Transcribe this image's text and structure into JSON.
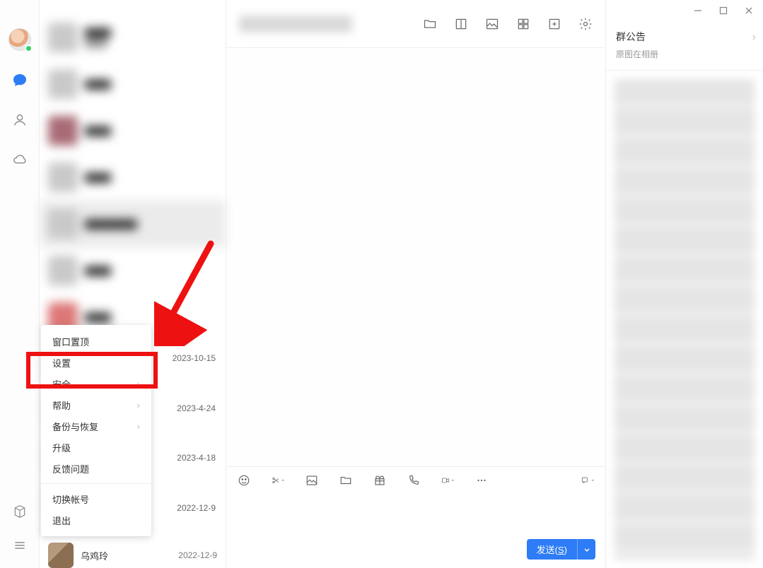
{
  "sidebar": {
    "icons": [
      "chat",
      "contacts",
      "cloud",
      "cube",
      "menu"
    ]
  },
  "chat_dates": {
    "d1": "2023-10-15",
    "d2": "2023-4-24",
    "d3": "2023-4-18",
    "d4": "2022-12-9",
    "d5": "2022-12-9"
  },
  "visible_chat": {
    "name": "乌鸡玲",
    "date": "2022-12-9"
  },
  "context_menu": {
    "pin_top": "窗口置顶",
    "settings": "设置",
    "security": "安全",
    "help": "帮助",
    "backup": "备份与恢复",
    "upgrade": "升级",
    "feedback": "反馈问题",
    "switch_account": "切换帐号",
    "exit": "退出"
  },
  "right_panel": {
    "title": "群公告",
    "subtitle": "原图在相册"
  },
  "send": {
    "label_prefix": "发送(",
    "hotkey": "S",
    "label_suffix": ")"
  }
}
